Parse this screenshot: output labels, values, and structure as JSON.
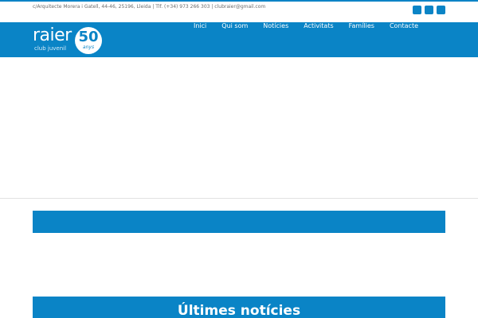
{
  "topbar": {
    "contact": "c/Arquitecte Morera i Gatell, 44-46, 25196, Lleida | Tlf. (+34) 973 266 303 | clubraier@gmail.com",
    "social_icons": [
      "social-icon-1",
      "social-icon-2",
      "social-icon-3"
    ]
  },
  "logo": {
    "word": "raier",
    "subtitle": "club juvenil",
    "badge_number": "50",
    "badge_text": "anys"
  },
  "nav": {
    "items": [
      {
        "label": "Inici",
        "active": true
      },
      {
        "label": "Qui som",
        "active": false
      },
      {
        "label": "Notícies",
        "active": false
      },
      {
        "label": "Activitats",
        "active": false
      },
      {
        "label": "Famílies",
        "active": false
      },
      {
        "label": "Contacte",
        "active": false
      }
    ]
  },
  "sections": {
    "latest_news_title": "Últimes notícies"
  },
  "colors": {
    "accent": "#0a84c6",
    "text_muted": "#6b6b6b",
    "white": "#ffffff"
  }
}
